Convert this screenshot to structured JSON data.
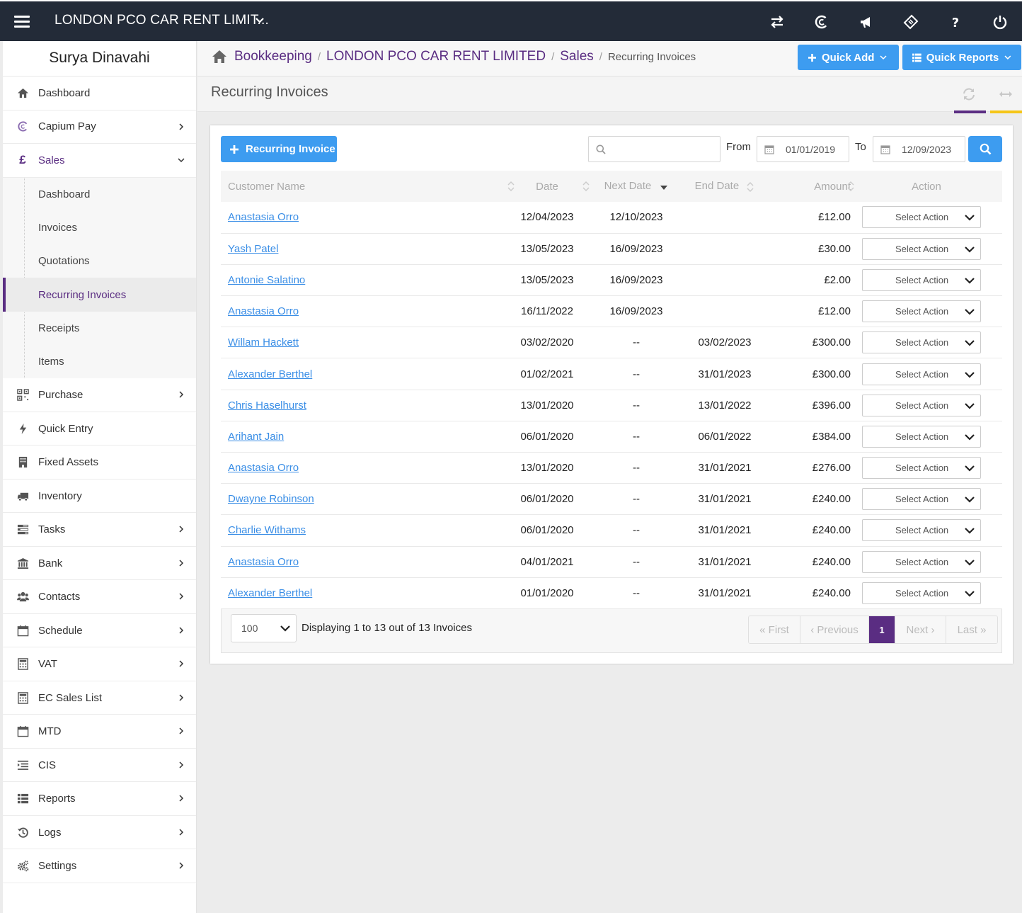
{
  "topbar": {
    "company": "LONDON PCO CAR RENT LIMIT...",
    "icons": [
      "transfer-icon",
      "capium-icon",
      "megaphone-icon",
      "ticket-icon",
      "help-icon",
      "power-icon"
    ]
  },
  "sidebar": {
    "user": "Surya Dinavahi",
    "items": [
      {
        "label": "Dashboard"
      },
      {
        "label": "Capium Pay"
      },
      {
        "label": "Sales",
        "icon_text": "£"
      },
      {
        "label": "Purchase"
      },
      {
        "label": "Quick Entry"
      },
      {
        "label": "Fixed Assets"
      },
      {
        "label": "Inventory"
      },
      {
        "label": "Tasks"
      },
      {
        "label": "Bank"
      },
      {
        "label": "Contacts"
      },
      {
        "label": "Schedule"
      },
      {
        "label": "VAT"
      },
      {
        "label": "EC Sales List"
      },
      {
        "label": "MTD"
      },
      {
        "label": "CIS"
      },
      {
        "label": "Reports"
      },
      {
        "label": "Logs"
      },
      {
        "label": "Settings"
      }
    ],
    "sales_sub": [
      {
        "label": "Dashboard"
      },
      {
        "label": "Invoices"
      },
      {
        "label": "Quotations"
      },
      {
        "label": "Recurring Invoices"
      },
      {
        "label": "Receipts"
      },
      {
        "label": "Items"
      }
    ]
  },
  "breadcrumb": {
    "items": [
      "Bookkeeping",
      "LONDON PCO CAR RENT LIMITED",
      "Sales"
    ],
    "current": "Recurring Invoices"
  },
  "header_buttons": {
    "quick_add": "Quick Add",
    "quick_reports": "Quick Reports"
  },
  "page": {
    "title": "Recurring Invoices"
  },
  "toolbar": {
    "new_button": "Recurring Invoice",
    "search_placeholder": "",
    "from_label": "From",
    "from_date": "01/01/2019",
    "to_label": "To",
    "to_date": "12/09/2023"
  },
  "table": {
    "columns": [
      "Customer Name",
      "Date",
      "Next Date",
      "End Date",
      "Amount",
      "Action"
    ],
    "action_placeholder": "Select Action",
    "rows": [
      {
        "name": "Anastasia Orro",
        "date": "12/04/2023",
        "next": "12/10/2023",
        "end": "",
        "amount": "£12.00"
      },
      {
        "name": "Yash Patel",
        "date": "13/05/2023",
        "next": "16/09/2023",
        "end": "",
        "amount": "£30.00"
      },
      {
        "name": "Antonie Salatino",
        "date": "13/05/2023",
        "next": "16/09/2023",
        "end": "",
        "amount": "£2.00"
      },
      {
        "name": "Anastasia Orro",
        "date": "16/11/2022",
        "next": "16/09/2023",
        "end": "",
        "amount": "£12.00"
      },
      {
        "name": "Willam Hackett",
        "date": "03/02/2020",
        "next": "--",
        "end": "03/02/2023",
        "amount": "£300.00"
      },
      {
        "name": "Alexander Berthel",
        "date": "01/02/2021",
        "next": "--",
        "end": "31/01/2023",
        "amount": "£300.00"
      },
      {
        "name": "Chris Haselhurst",
        "date": "13/01/2020",
        "next": "--",
        "end": "13/01/2022",
        "amount": "£396.00"
      },
      {
        "name": "Arihant Jain",
        "date": "06/01/2020",
        "next": "--",
        "end": "06/01/2022",
        "amount": "£384.00"
      },
      {
        "name": "Anastasia Orro",
        "date": "13/01/2020",
        "next": "--",
        "end": "31/01/2021",
        "amount": "£276.00"
      },
      {
        "name": "Dwayne Robinson",
        "date": "06/01/2020",
        "next": "--",
        "end": "31/01/2021",
        "amount": "£240.00"
      },
      {
        "name": "Charlie Withams",
        "date": "06/01/2020",
        "next": "--",
        "end": "31/01/2021",
        "amount": "£240.00"
      },
      {
        "name": "Anastasia Orro",
        "date": "04/01/2021",
        "next": "--",
        "end": "31/01/2021",
        "amount": "£240.00"
      },
      {
        "name": "Alexander Berthel",
        "date": "01/01/2020",
        "next": "--",
        "end": "31/01/2021",
        "amount": "£240.00"
      }
    ]
  },
  "footer": {
    "page_size": "100",
    "display_text": "Displaying 1 to 13 out of 13 Invoices",
    "pager": {
      "first": "« First",
      "previous": "‹ Previous",
      "current": "1",
      "next": "Next ›",
      "last": "Last »"
    }
  },
  "colors": {
    "brand_purple": "#5a2d82",
    "accent_blue": "#3d9cf0",
    "accent_yellow": "#f5c518",
    "topbar": "#232b38"
  }
}
